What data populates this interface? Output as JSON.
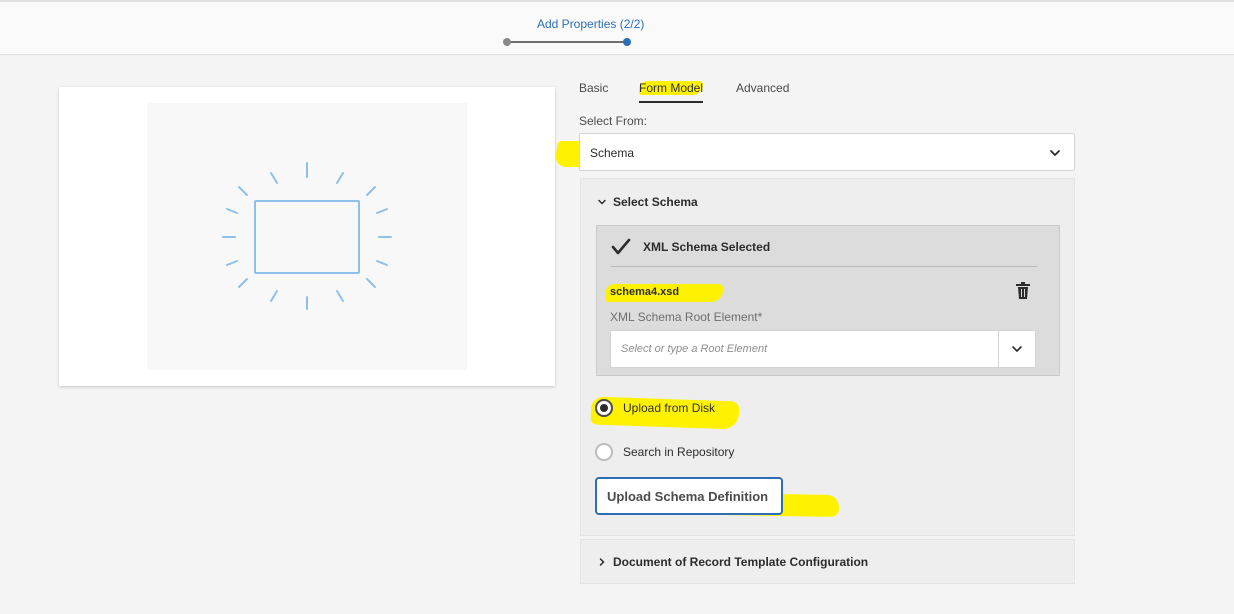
{
  "wizard": {
    "step_title": "Add Properties (2/2)",
    "colors": {
      "active": "#2d6eb7",
      "done": "#8a8a8a"
    }
  },
  "tabs": [
    {
      "label": "Basic",
      "active": false
    },
    {
      "label": "Form Model",
      "active": true
    },
    {
      "label": "Advanced",
      "active": false
    }
  ],
  "select_from": {
    "label": "Select From:",
    "value": "Schema"
  },
  "select_schema": {
    "heading": "Select Schema",
    "expanded": true,
    "status": "XML Schema Selected",
    "file_name": "schema4.xsd",
    "root_element_label": "XML Schema Root Element*",
    "root_element_placeholder": "Select or type a Root Element",
    "options": [
      {
        "label": "Upload from Disk",
        "checked": true
      },
      {
        "label": "Search in Repository",
        "checked": false
      }
    ],
    "upload_button": "Upload Schema Definition"
  },
  "dor_config": {
    "heading": "Document of Record Template Configuration",
    "expanded": false
  },
  "icons": {
    "preview": "form-placeholder-icon",
    "check": "checkmark-icon",
    "delete": "trash-icon",
    "dropdown": "chevron-down-icon",
    "collapse": "chevron-right-icon"
  },
  "highlight_color": "#fff200"
}
